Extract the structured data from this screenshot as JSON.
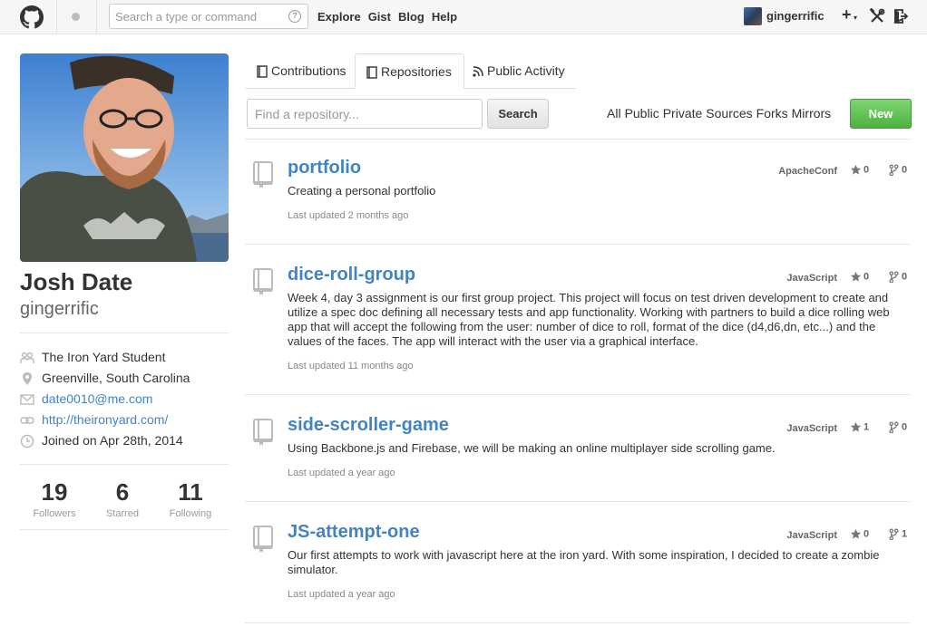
{
  "header": {
    "search_placeholder": "Search a type or command",
    "help_glyph": "?",
    "nav": [
      "Explore",
      "Gist",
      "Blog",
      "Help"
    ],
    "username": "gingerrific",
    "plus": "+",
    "caret": "▾"
  },
  "profile": {
    "fullname": "Josh Date",
    "login": "gingerrific",
    "organization": "The Iron Yard Student",
    "location": "Greenville, South Carolina",
    "email": "date0010@me.com",
    "website": "http://theironyard.com/",
    "joined": "Joined on Apr 28th, 2014",
    "stats": [
      {
        "num": "19",
        "label": "Followers"
      },
      {
        "num": "6",
        "label": "Starred"
      },
      {
        "num": "11",
        "label": "Following"
      }
    ]
  },
  "tabs": [
    "Contributions",
    "Repositories",
    "Public Activity"
  ],
  "filter": {
    "placeholder": "Find a repository...",
    "search_label": "Search",
    "types": [
      "All",
      "Public",
      "Private",
      "Sources",
      "Forks",
      "Mirrors"
    ],
    "new_label": "New"
  },
  "repos": [
    {
      "name": "portfolio",
      "language": "ApacheConf",
      "stars": "0",
      "forks": "0",
      "description": "Creating a personal portfolio",
      "updated": "Last updated 2 months ago"
    },
    {
      "name": "dice-roll-group",
      "language": "JavaScript",
      "stars": "0",
      "forks": "0",
      "description": "Week 4, day 3 assignment is our first group project. This project will focus on test driven development to create and utilize a spec doc defining all necessary tests and app functionality. Working with partners to build a dice rolling web app that will accept the following from the user: number of dice to roll, format of the dice (d4,d6,dn, etc...) and the values of the faces. The app will interact with the user via a graphical interface.",
      "updated": "Last updated 11 months ago"
    },
    {
      "name": "side-scroller-game",
      "language": "JavaScript",
      "stars": "1",
      "forks": "0",
      "description": "Using Backbone.js and Firebase, we will be making an online multiplayer side scrolling game.",
      "updated": "Last updated a year ago"
    },
    {
      "name": "JS-attempt-one",
      "language": "JavaScript",
      "stars": "0",
      "forks": "1",
      "description": "Our first attempts to work with javascript here at the iron yard. With some inspiration, I decided to create a zombie simulator.",
      "updated": "Last updated a year ago"
    }
  ],
  "colors": {
    "link": "#4183c4",
    "new_button": "#55b545",
    "header_bg": "#f6f6f6"
  },
  "icons": {
    "logo": "octocat-icon",
    "repo": "repo-book-icon",
    "star": "star-icon",
    "fork": "fork-icon"
  }
}
